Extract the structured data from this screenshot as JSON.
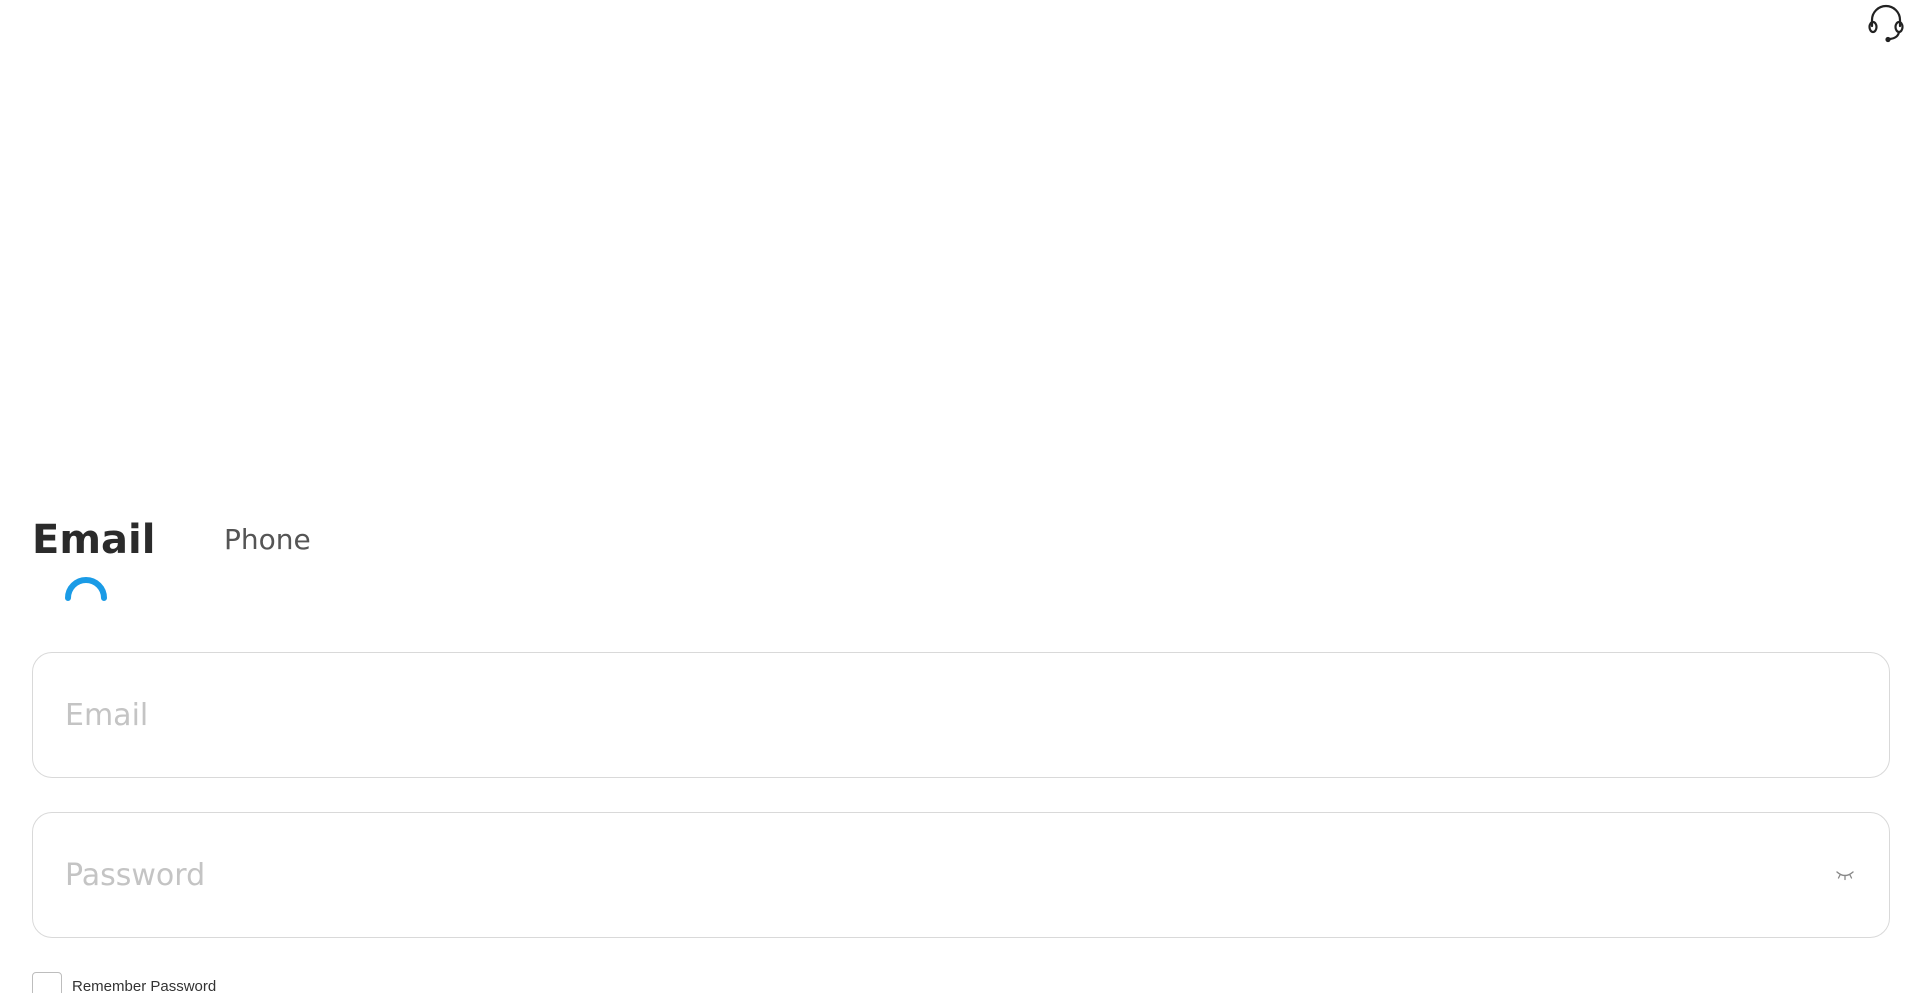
{
  "header": {
    "support_icon": "headset-icon"
  },
  "tabs": [
    {
      "label": "Email",
      "active": true
    },
    {
      "label": "Phone",
      "active": false
    }
  ],
  "tab_indicator": {
    "icon": "loading-arc-icon",
    "color": "#1a9be6"
  },
  "form": {
    "email": {
      "placeholder": "Email",
      "value": ""
    },
    "password": {
      "placeholder": "Password",
      "value": "",
      "toggle_icon": "eye-closed-icon"
    },
    "remember": {
      "label": "Remember Password",
      "checked": false
    }
  }
}
